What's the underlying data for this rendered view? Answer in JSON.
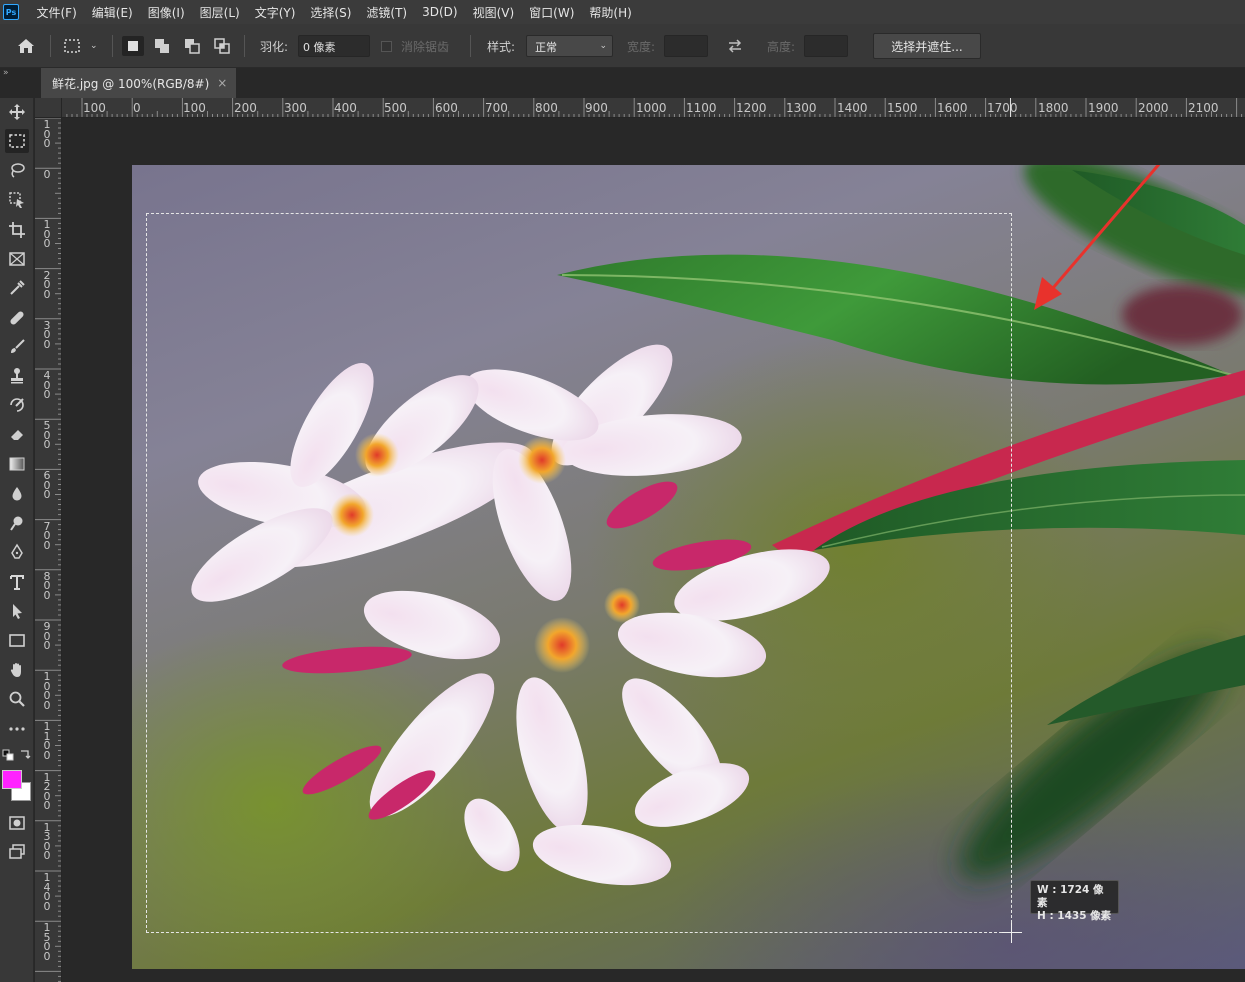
{
  "app": {
    "logo_text": "Ps"
  },
  "menu": [
    "文件(F)",
    "编辑(E)",
    "图像(I)",
    "图层(L)",
    "文字(Y)",
    "选择(S)",
    "滤镜(T)",
    "3D(D)",
    "视图(V)",
    "窗口(W)",
    "帮助(H)"
  ],
  "options": {
    "feather_label": "羽化:",
    "feather_value": "0 像素",
    "antialias_label": "消除锯齿",
    "style_label": "样式:",
    "style_value": "正常",
    "width_label": "宽度:",
    "height_label": "高度:",
    "select_mask_button": "选择并遮住..."
  },
  "document": {
    "tab_title": "鲜花.jpg @ 100%(RGB/8#)",
    "close_glyph": "×"
  },
  "ruler_h_labels": [
    "100",
    "0",
    "100",
    "200",
    "300",
    "400",
    "500",
    "600",
    "700",
    "800",
    "900",
    "1000",
    "1100",
    "1200",
    "1300",
    "1400",
    "1500",
    "1600",
    "1700",
    "1800",
    "1900",
    "2000",
    "2100"
  ],
  "ruler_v_labels": [
    "100",
    "0",
    "100",
    "200",
    "300",
    "400",
    "500",
    "600",
    "700",
    "800",
    "900",
    "1000",
    "1100",
    "1200",
    "1300",
    "1400",
    "1500"
  ],
  "selection_tooltip": {
    "width_text": "W : 1724 像素",
    "height_text": "H : 1435 像素"
  },
  "colors": {
    "foreground": "#ff22ff",
    "background": "#ffffff",
    "annotation_arrow": "#e8322c"
  },
  "tools": [
    "move-tool-icon",
    "rectangular-marquee-icon",
    "lasso-icon",
    "object-selection-icon",
    "crop-icon",
    "frame-icon",
    "eyedropper-icon",
    "healing-brush-icon",
    "brush-icon",
    "clone-stamp-icon",
    "history-brush-icon",
    "eraser-icon",
    "gradient-icon",
    "blur-icon",
    "dodge-icon",
    "pen-icon",
    "type-icon",
    "path-selection-icon",
    "rectangle-icon",
    "hand-icon",
    "zoom-icon",
    "more-tools-icon",
    "quick-mask-icon",
    "screen-mode-icon"
  ]
}
